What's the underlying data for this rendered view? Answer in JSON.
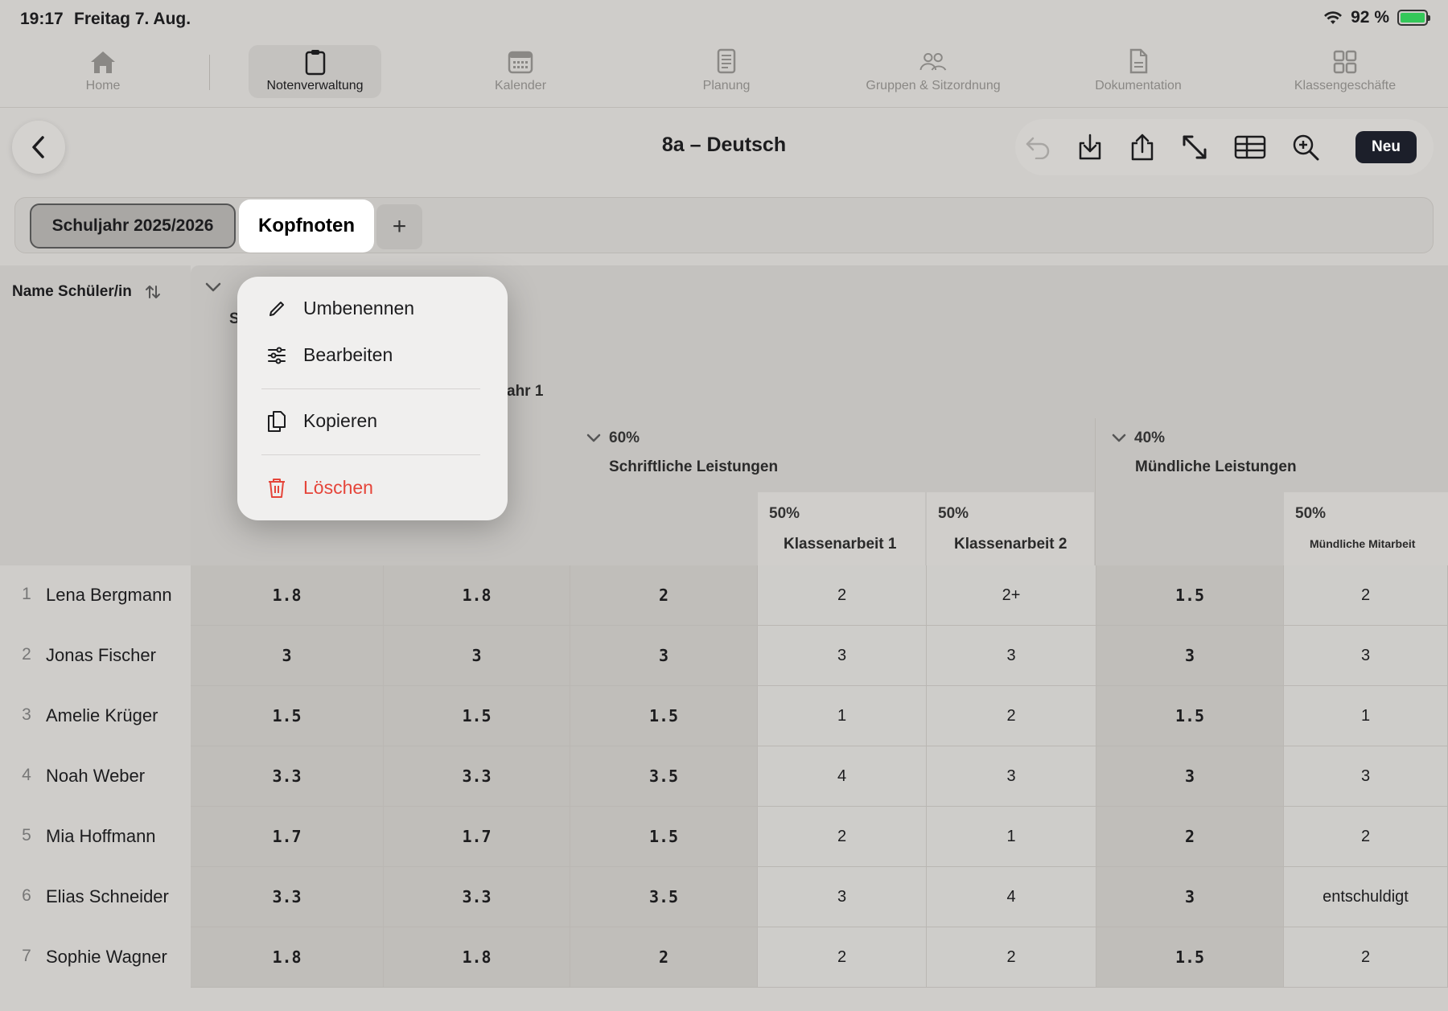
{
  "status": {
    "time": "19:17",
    "date": "Freitag 7. Aug.",
    "battery": "92 %"
  },
  "tabs": [
    {
      "label": "Home",
      "icon": "house-icon"
    },
    {
      "label": "Notenverwaltung",
      "icon": "clipboard-icon"
    },
    {
      "label": "Kalender",
      "icon": "calendar-icon"
    },
    {
      "label": "Planung",
      "icon": "document-lines-icon"
    },
    {
      "label": "Gruppen & Sitzordnung",
      "icon": "people-icon"
    },
    {
      "label": "Dokumentation",
      "icon": "doc-icon"
    },
    {
      "label": "Klassengeschäfte",
      "icon": "grid-icon"
    }
  ],
  "header": {
    "title": "8a – Deutsch",
    "new_label": "Neu"
  },
  "segments": {
    "year": "Schuljahr 2025/2026",
    "active": "Kopfnoten",
    "add": "+"
  },
  "table": {
    "name_header": "Name Schüler/in",
    "partial_header_s": "S",
    "partial_header_jahr": "ahr 1",
    "groups": [
      {
        "pct": "60%",
        "label": "Schriftliche Leistungen"
      },
      {
        "pct": "40%",
        "label": "Mündliche Leistungen"
      }
    ],
    "subcols": [
      {
        "pct": "50%",
        "label": "Klassenarbeit 1"
      },
      {
        "pct": "50%",
        "label": "Klassenarbeit 2"
      },
      {
        "pct": "50%",
        "label": "Mündliche Mitarbeit"
      }
    ],
    "rows": [
      {
        "n": "1",
        "name": "Lena Bergmann",
        "c": [
          "1.8",
          "1.8",
          "2",
          "2",
          "2+",
          "1.5",
          "2"
        ]
      },
      {
        "n": "2",
        "name": "Jonas Fischer",
        "c": [
          "3",
          "3",
          "3",
          "3",
          "3",
          "3",
          "3"
        ]
      },
      {
        "n": "3",
        "name": "Amelie Krüger",
        "c": [
          "1.5",
          "1.5",
          "1.5",
          "1",
          "2",
          "1.5",
          "1"
        ]
      },
      {
        "n": "4",
        "name": "Noah Weber",
        "c": [
          "3.3",
          "3.3",
          "3.5",
          "4",
          "3",
          "3",
          "3"
        ]
      },
      {
        "n": "5",
        "name": "Mia Hoffmann",
        "c": [
          "1.7",
          "1.7",
          "1.5",
          "2",
          "1",
          "2",
          "2"
        ]
      },
      {
        "n": "6",
        "name": "Elias Schneider",
        "c": [
          "3.3",
          "3.3",
          "3.5",
          "3",
          "4",
          "3",
          "entschuldigt"
        ]
      },
      {
        "n": "7",
        "name": "Sophie Wagner",
        "c": [
          "1.8",
          "1.8",
          "2",
          "2",
          "2",
          "1.5",
          "2"
        ]
      }
    ]
  },
  "menu": {
    "rename": "Umbenennen",
    "edit": "Bearbeiten",
    "copy": "Kopieren",
    "delete": "Löschen"
  },
  "colors": {
    "accent_dark": "#1c1f2a",
    "danger": "#e5453a",
    "battery": "#34c759"
  }
}
